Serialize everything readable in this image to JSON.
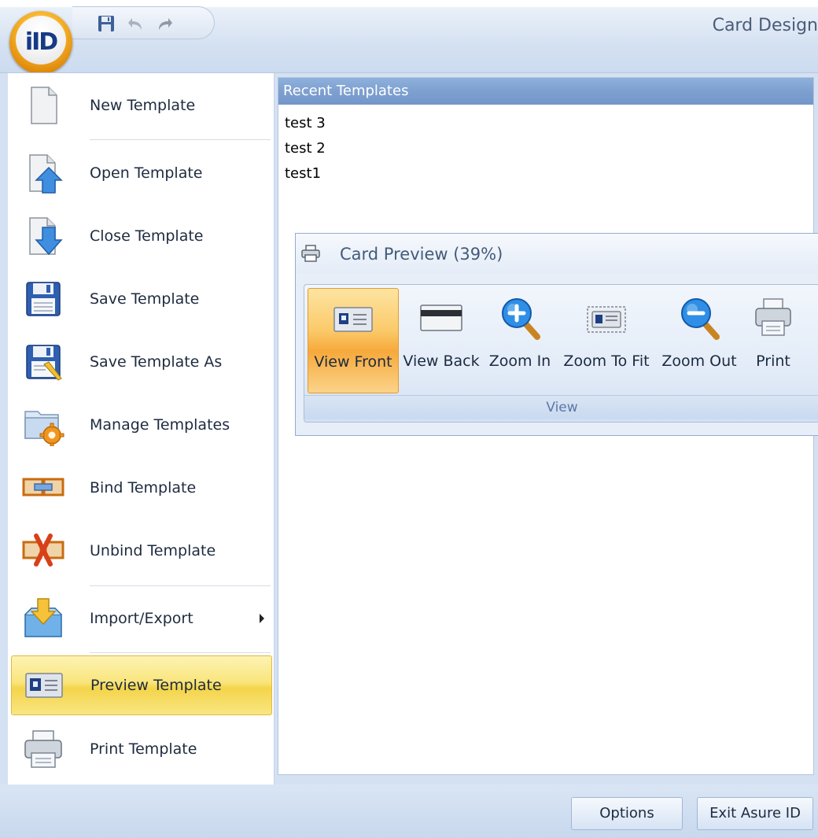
{
  "window": {
    "title": "Card Design",
    "app_button_text": "iID"
  },
  "quick_access": [
    {
      "name": "save-icon"
    },
    {
      "name": "undo-icon"
    },
    {
      "name": "redo-icon"
    }
  ],
  "menu": {
    "items": [
      {
        "label": "New Template",
        "icon": "new-document-icon"
      },
      {
        "label": "Open Template",
        "icon": "open-document-icon"
      },
      {
        "label": "Close Template",
        "icon": "close-document-icon"
      },
      {
        "label": "Save Template",
        "icon": "floppy-disk-icon"
      },
      {
        "label": "Save Template As",
        "icon": "floppy-disk-pencil-icon"
      },
      {
        "label": "Manage Templates",
        "icon": "folder-gear-icon"
      },
      {
        "label": "Bind Template",
        "icon": "bind-link-icon"
      },
      {
        "label": "Unbind Template",
        "icon": "unbind-link-icon"
      },
      {
        "label": "Import/Export",
        "icon": "import-export-icon",
        "submenu": true
      },
      {
        "label": "Preview Template",
        "icon": "id-card-icon",
        "active": true
      },
      {
        "label": "Print Template",
        "icon": "printer-icon"
      }
    ]
  },
  "recent": {
    "header": "Recent Templates",
    "items": [
      "test 3",
      "test 2",
      "test1"
    ]
  },
  "card_preview": {
    "title": "Card Preview (39%)",
    "buttons": [
      {
        "label": "View Front",
        "icon": "card-front-icon",
        "active": true
      },
      {
        "label": "View Back",
        "icon": "card-back-icon"
      },
      {
        "label": "Zoom In",
        "icon": "zoom-in-icon"
      },
      {
        "label": "Zoom To Fit",
        "icon": "zoom-to-fit-icon"
      },
      {
        "label": "Zoom Out",
        "icon": "zoom-out-icon"
      },
      {
        "label": "Print",
        "icon": "printer-icon"
      }
    ],
    "group_label": "View"
  },
  "footer": {
    "options_label": "Options",
    "exit_label": "Exit Asure ID"
  },
  "colors": {
    "accent_blue": "#7ea0d0",
    "highlight_yellow": "#f4d44a",
    "highlight_orange": "#f6a93b",
    "panel_bg": "#d4e1f2"
  }
}
